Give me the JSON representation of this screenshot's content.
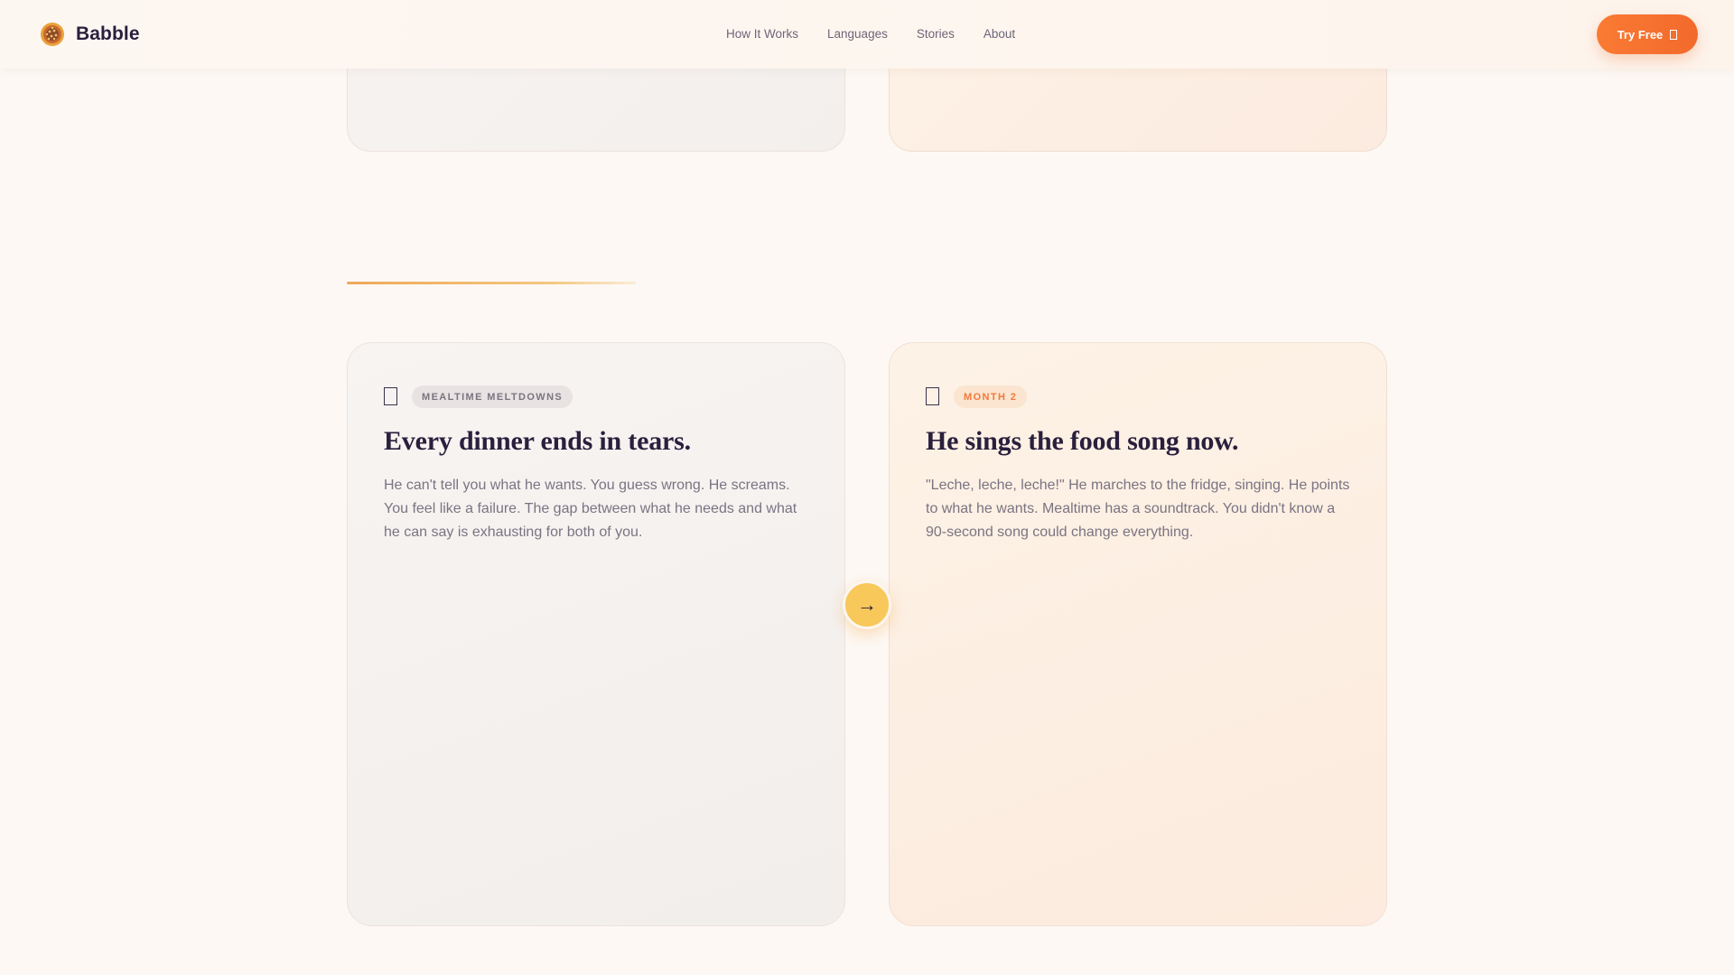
{
  "brand": {
    "name": "Babble",
    "logo_icon": "sunflower-icon"
  },
  "nav": {
    "links": [
      "How It Works",
      "Languages",
      "Stories",
      "About"
    ],
    "cta_label": "Try Free",
    "cta_icon": "square-icon"
  },
  "story": {
    "before": {
      "icon": "bookmark-icon",
      "tag": "MEALTIME MELTDOWNS",
      "title": "Every dinner ends in tears.",
      "text": "He can't tell you what he wants. You guess wrong. He screams. You feel like a failure. The gap between what he needs and what he can say is exhausting for both of you."
    },
    "after": {
      "icon": "bookmark-icon",
      "tag": "MONTH 2",
      "title": "He sings the food song now.",
      "text": "\"Leche, leche, leche!\" He marches to the fridge, singing. He points to what he wants. Mealtime has a soundtrack. You didn't know a 90-second song could change everything."
    },
    "arrow_glyph": "→"
  },
  "colors": {
    "accent_orange": "#f26a2c",
    "accent_yellow": "#f8c85a",
    "text_dark": "#2a1f3d",
    "text_muted": "#7a7482"
  }
}
